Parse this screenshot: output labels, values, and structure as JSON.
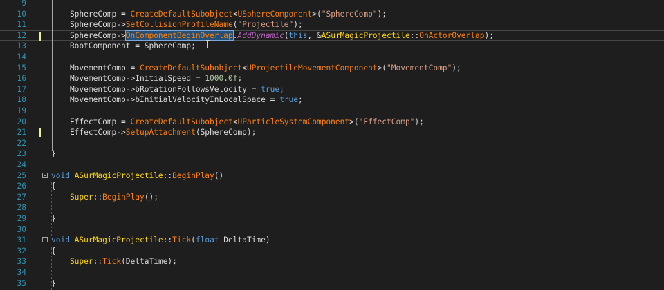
{
  "editor": {
    "colors": {
      "background": "#1e1e1e",
      "line_number": "#2b91af",
      "function": "#ff8000",
      "keyword": "#569cd6",
      "string": "#d69d85",
      "number": "#b5cea8",
      "macro": "#bd63c5",
      "change_marker": "#efef91"
    },
    "lines": [
      {
        "n": "9",
        "changed": false,
        "fold": false,
        "tokens": [
          [
            "plain",
            "    "
          ]
        ]
      },
      {
        "n": "10",
        "changed": false,
        "fold": false,
        "tokens": [
          [
            "var",
            "    SphereComp"
          ],
          [
            "plain",
            " = "
          ],
          [
            "func",
            "CreateDefaultSubobject"
          ],
          [
            "plain",
            "<"
          ],
          [
            "type",
            "USphereComponent"
          ],
          [
            "plain",
            ">("
          ],
          [
            "str",
            "\"SphereComp\""
          ],
          [
            "plain",
            ");"
          ]
        ]
      },
      {
        "n": "11",
        "changed": false,
        "fold": false,
        "tokens": [
          [
            "var",
            "    SphereComp"
          ],
          [
            "plain",
            "->"
          ],
          [
            "func",
            "SetCollisionProfileName"
          ],
          [
            "plain",
            "("
          ],
          [
            "str",
            "\"Projectile\""
          ],
          [
            "plain",
            ");"
          ]
        ]
      },
      {
        "n": "12",
        "changed": true,
        "fold": false,
        "current": true,
        "tokens": [
          [
            "var",
            "    SphereComp"
          ],
          [
            "plain",
            "->"
          ],
          [
            "sel",
            "OnComponentBeginOverlap"
          ],
          [
            "plain",
            "."
          ],
          [
            "macro",
            "AddDynamic"
          ],
          [
            "plain",
            "("
          ],
          [
            "kw",
            "this"
          ],
          [
            "plain",
            ", &"
          ],
          [
            "type2",
            "ASurMagicProjectile"
          ],
          [
            "plain",
            "::"
          ],
          [
            "func",
            "OnActorOverlap"
          ],
          [
            "plain",
            ");"
          ]
        ]
      },
      {
        "n": "13",
        "changed": false,
        "fold": false,
        "tokens": [
          [
            "var",
            "    RootComponent"
          ],
          [
            "plain",
            " = SphereComp;"
          ]
        ]
      },
      {
        "n": "14",
        "changed": false,
        "fold": false,
        "tokens": [
          [
            "plain",
            ""
          ]
        ]
      },
      {
        "n": "15",
        "changed": false,
        "fold": false,
        "tokens": [
          [
            "var",
            "    MovementComp"
          ],
          [
            "plain",
            " = "
          ],
          [
            "func",
            "CreateDefaultSubobject"
          ],
          [
            "plain",
            "<"
          ],
          [
            "type",
            "UProjectileMovementComponent"
          ],
          [
            "plain",
            ">("
          ],
          [
            "str",
            "\"MovementComp\""
          ],
          [
            "plain",
            ");"
          ]
        ]
      },
      {
        "n": "16",
        "changed": false,
        "fold": false,
        "tokens": [
          [
            "var",
            "    MovementComp"
          ],
          [
            "plain",
            "->"
          ],
          [
            "var",
            "InitialSpeed"
          ],
          [
            "plain",
            " = "
          ],
          [
            "num",
            "1000.0f"
          ],
          [
            "plain",
            ";"
          ]
        ]
      },
      {
        "n": "17",
        "changed": false,
        "fold": false,
        "tokens": [
          [
            "var",
            "    MovementComp"
          ],
          [
            "plain",
            "->"
          ],
          [
            "var",
            "bRotationFollowsVelocity"
          ],
          [
            "plain",
            " = "
          ],
          [
            "kw",
            "true"
          ],
          [
            "plain",
            ";"
          ]
        ]
      },
      {
        "n": "18",
        "changed": false,
        "fold": false,
        "tokens": [
          [
            "var",
            "    MovementComp"
          ],
          [
            "plain",
            "->"
          ],
          [
            "var",
            "bInitialVelocityInLocalSpace"
          ],
          [
            "plain",
            " = "
          ],
          [
            "kw",
            "true"
          ],
          [
            "plain",
            ";"
          ]
        ]
      },
      {
        "n": "19",
        "changed": false,
        "fold": false,
        "tokens": [
          [
            "plain",
            ""
          ]
        ]
      },
      {
        "n": "20",
        "changed": false,
        "fold": false,
        "tokens": [
          [
            "var",
            "    EffectComp"
          ],
          [
            "plain",
            " = "
          ],
          [
            "func",
            "CreateDefaultSubobject"
          ],
          [
            "plain",
            "<"
          ],
          [
            "type",
            "UParticleSystemComponent"
          ],
          [
            "plain",
            ">("
          ],
          [
            "str",
            "\"EffectComp\""
          ],
          [
            "plain",
            ");"
          ]
        ]
      },
      {
        "n": "21",
        "changed": true,
        "fold": false,
        "tokens": [
          [
            "var",
            "    EffectComp"
          ],
          [
            "plain",
            "->"
          ],
          [
            "func",
            "SetupAttachment"
          ],
          [
            "plain",
            "(SphereComp);"
          ]
        ]
      },
      {
        "n": "22",
        "changed": false,
        "fold": false,
        "tokens": [
          [
            "plain",
            ""
          ]
        ]
      },
      {
        "n": "23",
        "changed": false,
        "fold": false,
        "tokens": [
          [
            "plain",
            "}"
          ]
        ]
      },
      {
        "n": "24",
        "changed": false,
        "fold": false,
        "tokens": [
          [
            "plain",
            ""
          ]
        ]
      },
      {
        "n": "25",
        "changed": false,
        "fold": true,
        "tokens": [
          [
            "kw",
            "void "
          ],
          [
            "type2",
            "ASurMagicProjectile"
          ],
          [
            "plain",
            "::"
          ],
          [
            "func",
            "BeginPlay"
          ],
          [
            "plain",
            "()"
          ]
        ]
      },
      {
        "n": "26",
        "changed": false,
        "fold": false,
        "tokens": [
          [
            "plain",
            "{"
          ]
        ]
      },
      {
        "n": "27",
        "changed": false,
        "fold": false,
        "tokens": [
          [
            "type2",
            "    Super"
          ],
          [
            "plain",
            "::"
          ],
          [
            "func",
            "BeginPlay"
          ],
          [
            "plain",
            "();"
          ]
        ]
      },
      {
        "n": "28",
        "changed": false,
        "fold": false,
        "tokens": [
          [
            "plain",
            ""
          ]
        ]
      },
      {
        "n": "29",
        "changed": false,
        "fold": false,
        "tokens": [
          [
            "plain",
            "}"
          ]
        ]
      },
      {
        "n": "30",
        "changed": false,
        "fold": false,
        "tokens": [
          [
            "plain",
            ""
          ]
        ]
      },
      {
        "n": "31",
        "changed": false,
        "fold": true,
        "tokens": [
          [
            "kw",
            "void "
          ],
          [
            "type2",
            "ASurMagicProjectile"
          ],
          [
            "plain",
            "::"
          ],
          [
            "func",
            "Tick"
          ],
          [
            "plain",
            "("
          ],
          [
            "kw",
            "float"
          ],
          [
            "plain",
            " DeltaTime)"
          ]
        ]
      },
      {
        "n": "32",
        "changed": false,
        "fold": false,
        "tokens": [
          [
            "plain",
            "{"
          ]
        ]
      },
      {
        "n": "33",
        "changed": false,
        "fold": false,
        "tokens": [
          [
            "type2",
            "    Super"
          ],
          [
            "plain",
            "::"
          ],
          [
            "func",
            "Tick"
          ],
          [
            "plain",
            "(DeltaTime);"
          ]
        ]
      },
      {
        "n": "34",
        "changed": false,
        "fold": false,
        "tokens": [
          [
            "plain",
            ""
          ]
        ]
      },
      {
        "n": "35",
        "changed": false,
        "fold": false,
        "tokens": [
          [
            "plain",
            "}"
          ]
        ]
      }
    ]
  }
}
